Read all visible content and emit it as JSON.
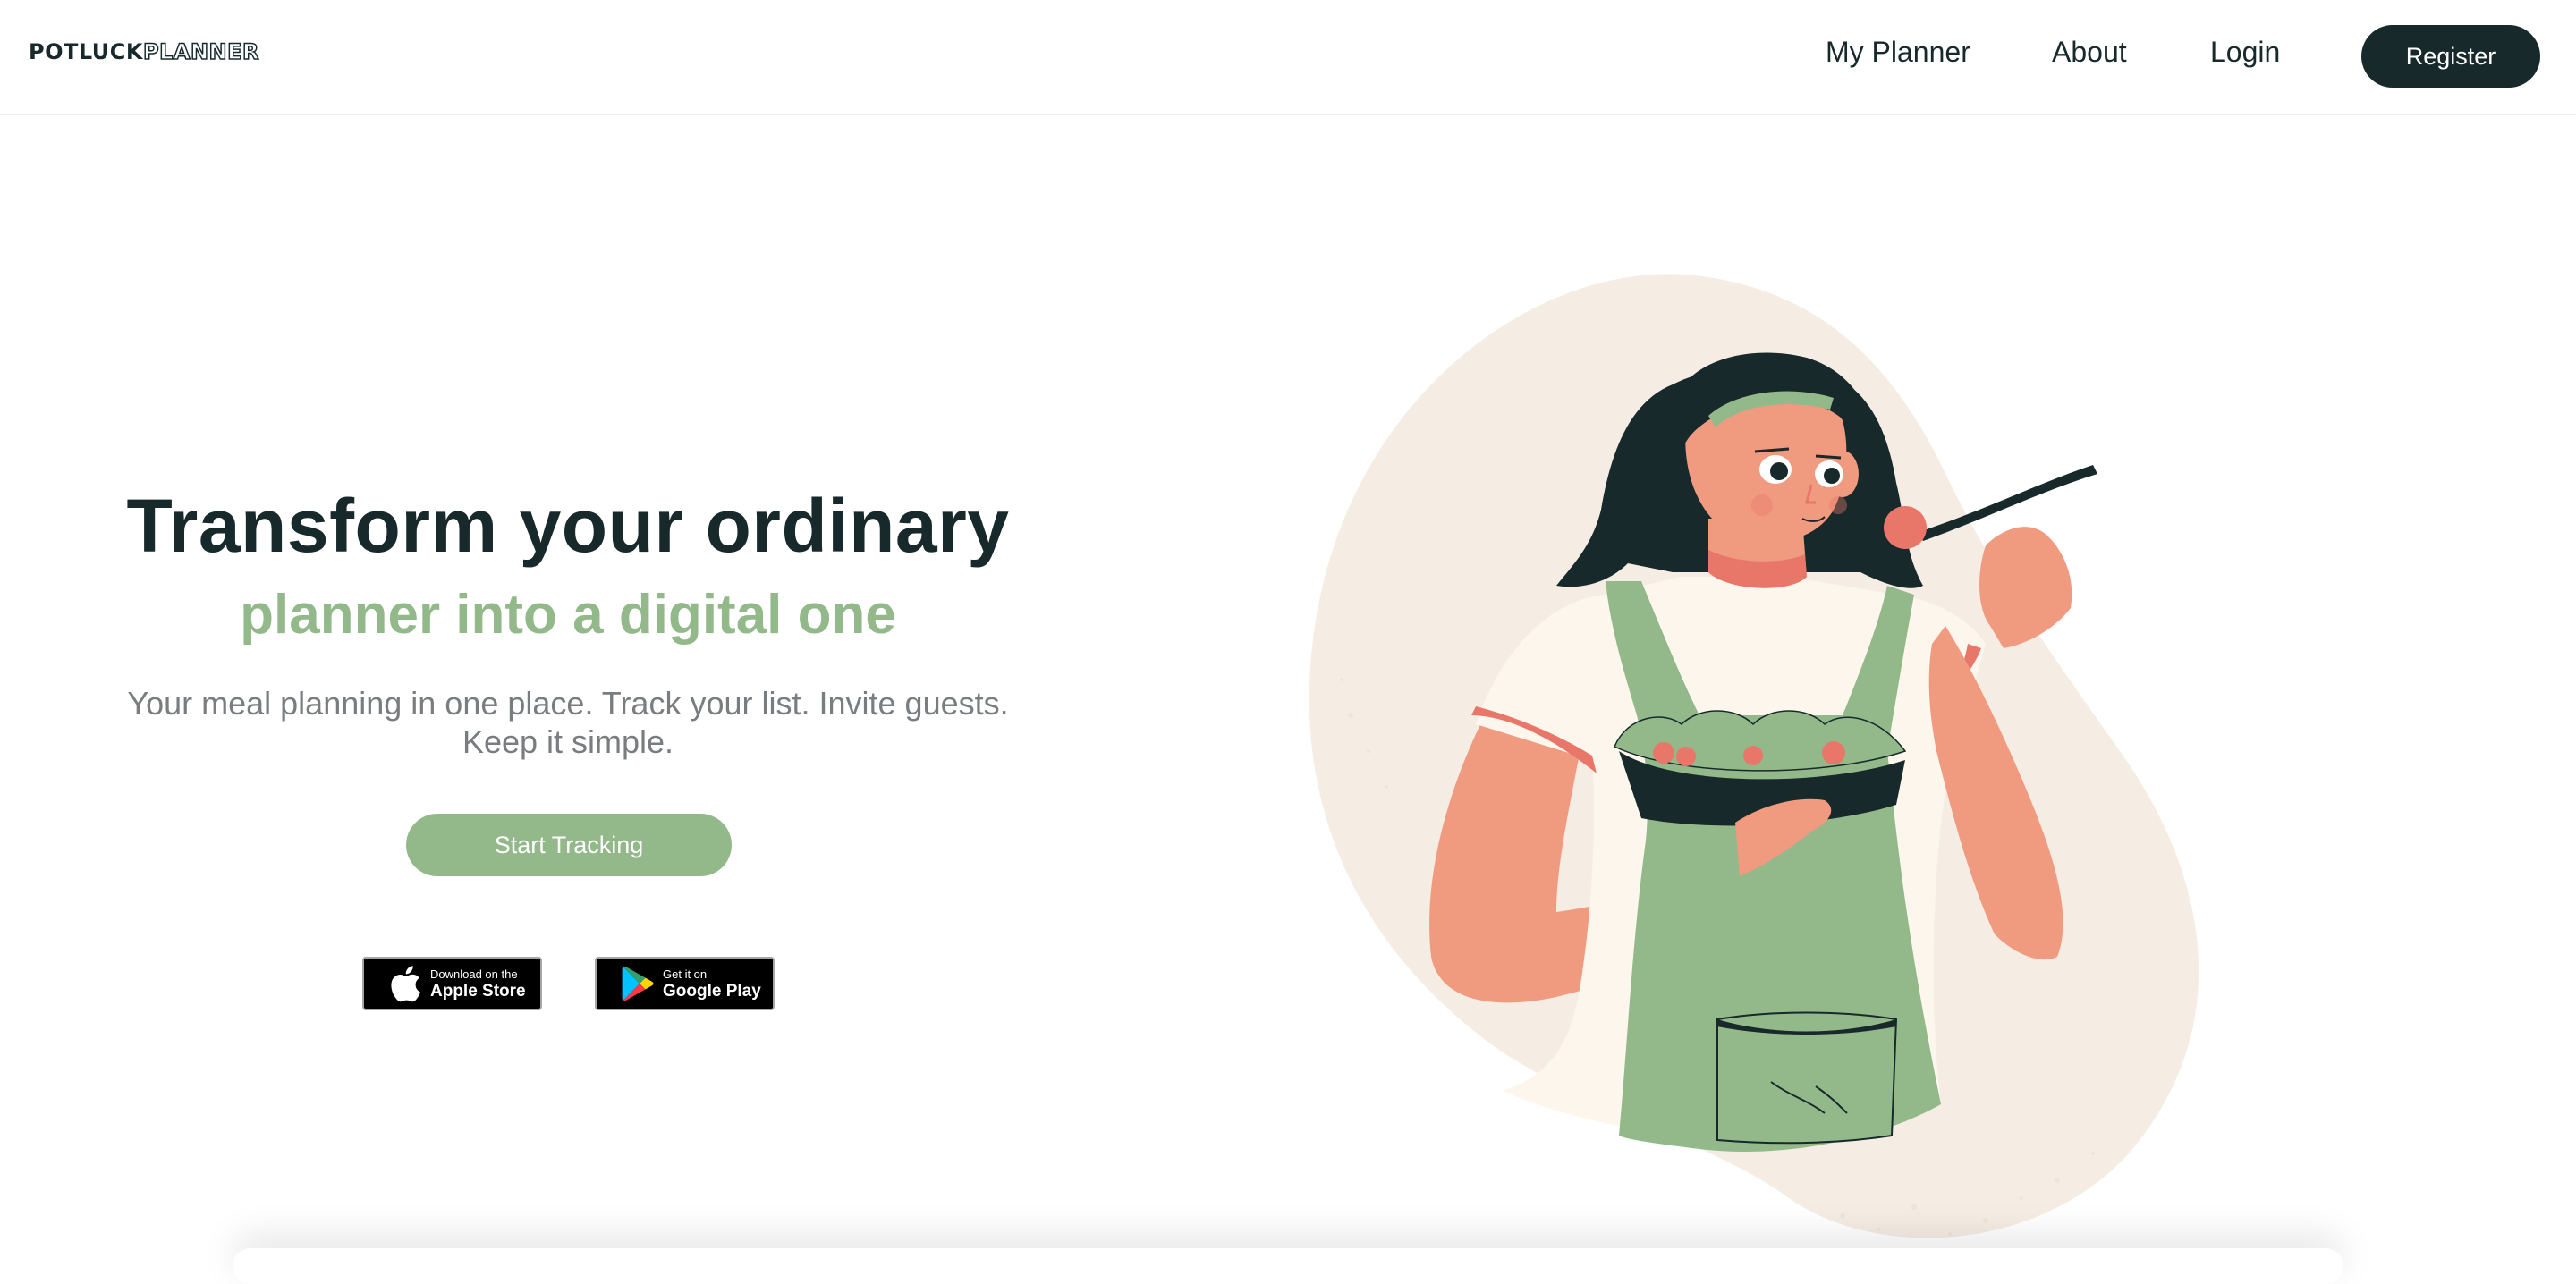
{
  "header": {
    "logo_part1": "POTLUCK",
    "logo_part2": "PLANNER",
    "nav": {
      "my_planner": "My Planner",
      "about": "About",
      "login": "Login"
    },
    "register_label": "Register"
  },
  "hero": {
    "title": "Transform your ordinary",
    "subtitle": "planner into a digital one",
    "description_line1": "Your meal planning in one place. Track your list. Invite guests.",
    "description_line2": "Keep it simple.",
    "cta_label": "Start Tracking"
  },
  "badges": {
    "apple": {
      "small": "Download on the",
      "big": "Apple Store",
      "icon": "apple-icon"
    },
    "google": {
      "small": "Get it on",
      "big": "Google Play",
      "icon": "google-play-icon"
    }
  },
  "illustration": {
    "subject": "woman-eating-salad-illustration"
  },
  "colors": {
    "dark": "#17292a",
    "accent_green": "#93b98b",
    "muted_text": "#7a7d7f",
    "blob_beige": "#f5ede3",
    "skin": "#f09a80",
    "tomato": "#e8776a"
  }
}
